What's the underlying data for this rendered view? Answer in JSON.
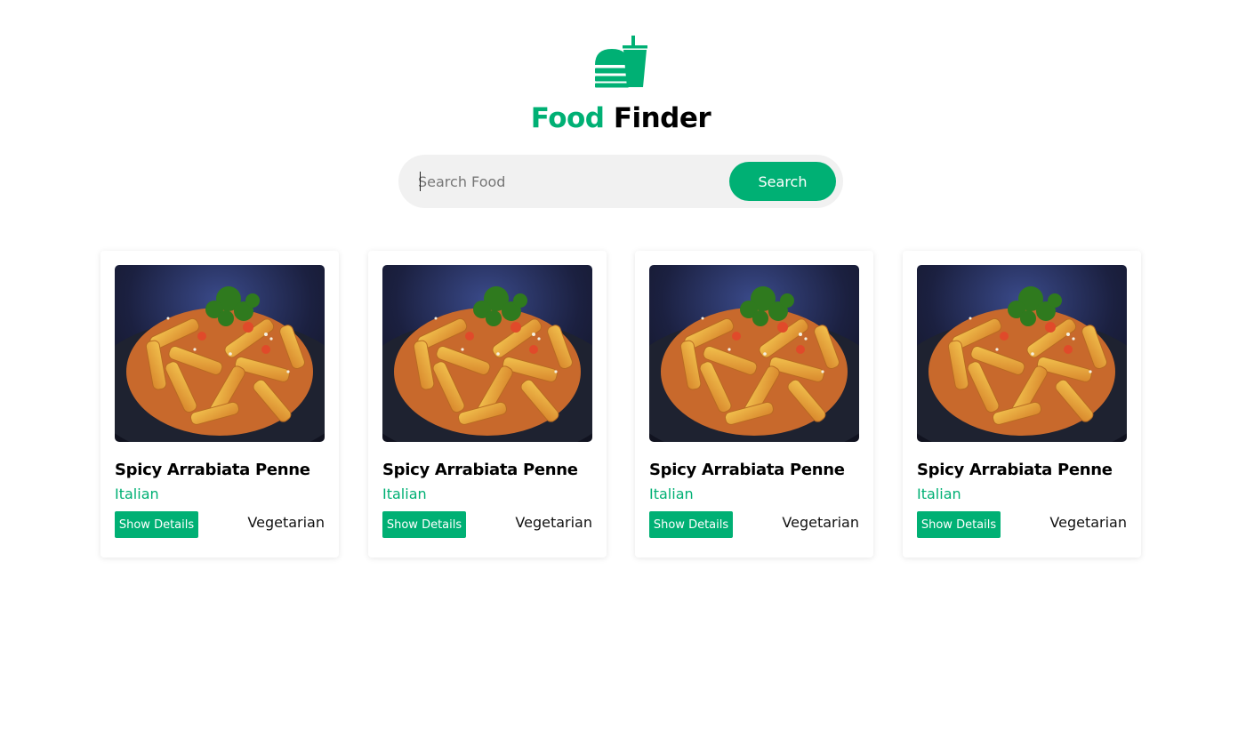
{
  "brand": {
    "logo_icon": "burger-drink-icon",
    "title_accent": "Food",
    "title_rest": "Finder",
    "accent_color": "#00b074"
  },
  "search": {
    "placeholder": "Search Food",
    "value": "",
    "button_label": "Search"
  },
  "meals": [
    {
      "name": "Spicy Arrabiata Penne",
      "area": "Italian",
      "button_label": "Show Details",
      "category": "Vegetarian",
      "image": "penne-pasta-photo"
    },
    {
      "name": "Spicy Arrabiata Penne",
      "area": "Italian",
      "button_label": "Show Details",
      "category": "Vegetarian",
      "image": "penne-pasta-photo"
    },
    {
      "name": "Spicy Arrabiata Penne",
      "area": "Italian",
      "button_label": "Show Details",
      "category": "Vegetarian",
      "image": "penne-pasta-photo"
    },
    {
      "name": "Spicy Arrabiata Penne",
      "area": "Italian",
      "button_label": "Show Details",
      "category": "Vegetarian",
      "image": "penne-pasta-photo"
    }
  ]
}
